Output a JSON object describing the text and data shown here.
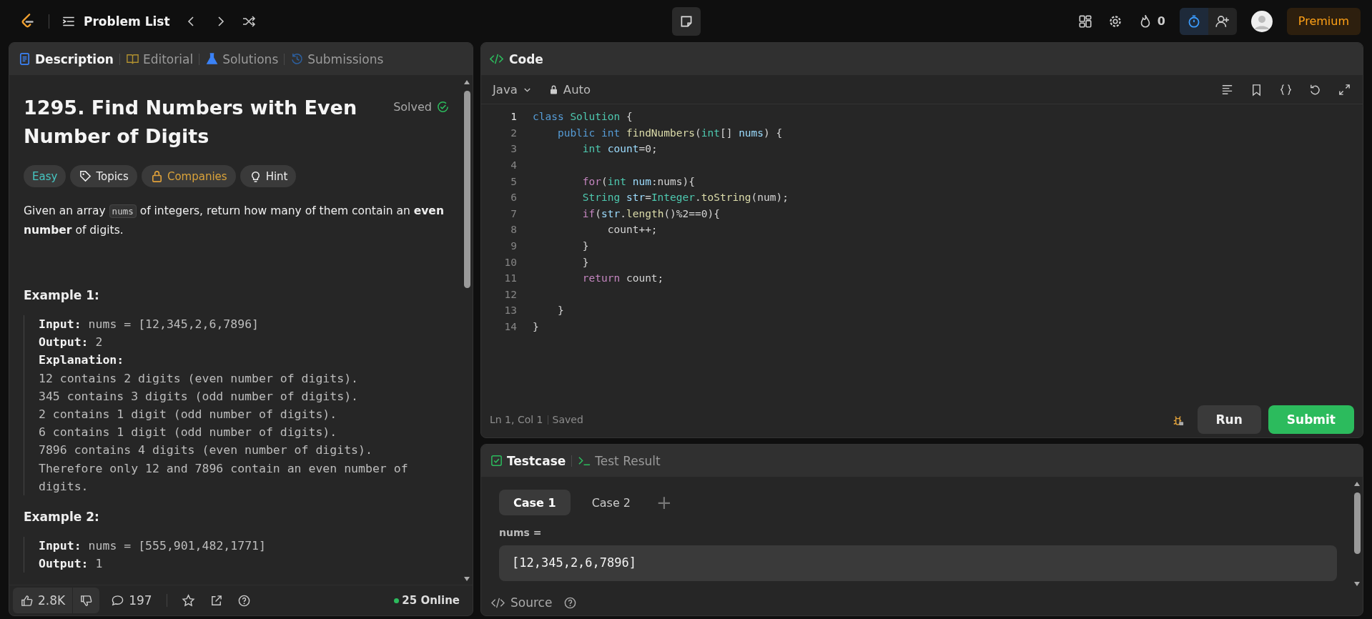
{
  "top_bar": {
    "title": "Problem List",
    "streak": "0",
    "premium": "Premium"
  },
  "left_tabs": [
    {
      "label": "Description",
      "kind": "description",
      "selected": true
    },
    {
      "label": "Editorial",
      "kind": "editorial",
      "selected": false
    },
    {
      "label": "Solutions",
      "kind": "solutions",
      "selected": false
    },
    {
      "label": "Submissions",
      "kind": "submissions",
      "selected": false
    }
  ],
  "problem": {
    "title": "1295. Find Numbers with Even Number of Digits",
    "status": "Solved",
    "tags": [
      {
        "label": "Easy",
        "kind": "difficulty"
      },
      {
        "label": "Topics",
        "kind": "topics"
      },
      {
        "label": "Companies",
        "kind": "companies"
      },
      {
        "label": "Hint",
        "kind": "hint"
      }
    ],
    "description": {
      "before": "Given an array",
      "code": "nums",
      "after": "of integers, return how many of them contain an **even number** of digits."
    },
    "examples": [
      {
        "heading": "Example 1:",
        "lines": [
          {
            "label": "Input:",
            "text": "nums = [12,345,2,6,7896]"
          },
          {
            "label": "Output:",
            "text": "2"
          },
          {
            "label": "Explanation:"
          },
          {
            "text": "12 contains 2 digits (even number of digits)."
          },
          {
            "text": "345 contains 3 digits (odd number of digits)."
          },
          {
            "text": "2 contains 1 digit (odd number of digits)."
          },
          {
            "text": "6 contains 1 digit (odd number of digits)."
          },
          {
            "text": "7896 contains 4 digits (even number of digits)."
          },
          {
            "text": "Therefore only 12 and 7896 contain an even number of digits."
          }
        ]
      },
      {
        "heading": "Example 2:",
        "lines": [
          {
            "label": "Input:",
            "text": "nums = [555,901,482,1771]"
          },
          {
            "label": "Output:",
            "text": "1"
          }
        ]
      }
    ]
  },
  "left_footer": {
    "likes": "2.8K",
    "comments": "197",
    "online": "25 Online"
  },
  "code_panel": {
    "title": "Code",
    "language": "Java",
    "mode": "Auto",
    "lines": [
      {
        "number": "1",
        "active": true,
        "tokens": [
          {
            "t": "class ",
            "kind": "kw"
          },
          {
            "t": "Solution",
            "kind": "type"
          },
          {
            "t": " {",
            "kind": "plain"
          }
        ]
      },
      {
        "number": "2",
        "active": false,
        "tokens": [
          {
            "t": "    public int ",
            "kind": "kw"
          },
          {
            "t": "findNumbers",
            "kind": "fn"
          },
          {
            "t": "(",
            "kind": "plain"
          },
          {
            "t": "int",
            "kind": "type"
          },
          {
            "t": "[] ",
            "kind": "plain"
          },
          {
            "t": "nums",
            "kind": "var"
          },
          {
            "t": ") {",
            "kind": "plain"
          }
        ]
      },
      {
        "number": "3",
        "active": false,
        "tokens": [
          {
            "t": "        int ",
            "kind": "type"
          },
          {
            "t": "count",
            "kind": "var"
          },
          {
            "t": "=0;",
            "kind": "plain"
          }
        ]
      },
      {
        "number": "4",
        "active": false
      },
      {
        "number": "5",
        "active": false,
        "tokens": [
          {
            "t": "        for",
            "kind": "ctrl"
          },
          {
            "t": "(",
            "kind": "plain"
          },
          {
            "t": "int ",
            "kind": "type"
          },
          {
            "t": "num",
            "kind": "var"
          },
          {
            "t": ":nums){",
            "kind": "plain"
          }
        ]
      },
      {
        "number": "6",
        "active": false,
        "tokens": [
          {
            "t": "        String ",
            "kind": "type"
          },
          {
            "t": "str",
            "kind": "var"
          },
          {
            "t": "=",
            "kind": "plain"
          },
          {
            "t": "Integer",
            "kind": "type"
          },
          {
            "t": ".",
            "kind": "plain"
          },
          {
            "t": "toString",
            "kind": "fn"
          },
          {
            "t": "(num);",
            "kind": "plain"
          }
        ]
      },
      {
        "number": "7",
        "active": false,
        "tokens": [
          {
            "t": "        if",
            "kind": "ctrl"
          },
          {
            "t": "(",
            "kind": "plain"
          },
          {
            "t": "str",
            "kind": "var"
          },
          {
            "t": ".",
            "kind": "plain"
          },
          {
            "t": "length",
            "kind": "fn"
          },
          {
            "t": "()%2==0){",
            "kind": "plain"
          }
        ]
      },
      {
        "number": "8",
        "active": false,
        "tokens": [
          {
            "t": "            count++;",
            "kind": "plain"
          }
        ]
      },
      {
        "number": "9",
        "active": false,
        "tokens": [
          {
            "t": "        }",
            "kind": "plain"
          }
        ]
      },
      {
        "number": "10",
        "active": false,
        "tokens": [
          {
            "t": "        }",
            "kind": "plain"
          }
        ]
      },
      {
        "number": "11",
        "active": false,
        "tokens": [
          {
            "t": "        return ",
            "kind": "ctrl"
          },
          {
            "t": "count;",
            "kind": "plain"
          }
        ]
      },
      {
        "number": "12",
        "active": false
      },
      {
        "number": "13",
        "active": false,
        "tokens": [
          {
            "t": "    }",
            "kind": "plain"
          }
        ]
      },
      {
        "number": "14",
        "active": false,
        "tokens": [
          {
            "t": "}",
            "kind": "plain"
          }
        ]
      }
    ],
    "position": "Ln 1, Col 1",
    "save_state": "Saved",
    "run": "Run",
    "submit": "Submit"
  },
  "test_tabs": [
    {
      "label": "Testcase",
      "kind": "testcase",
      "selected": true
    },
    {
      "label": "Test Result",
      "kind": "result",
      "selected": false
    }
  ],
  "cases": [
    {
      "label": "Case 1",
      "selected": true
    },
    {
      "label": "Case 2",
      "selected": false
    }
  ],
  "add_case": "+",
  "input": {
    "label": "nums =",
    "value": "[12,345,2,6,7896]"
  },
  "source": "Source"
}
